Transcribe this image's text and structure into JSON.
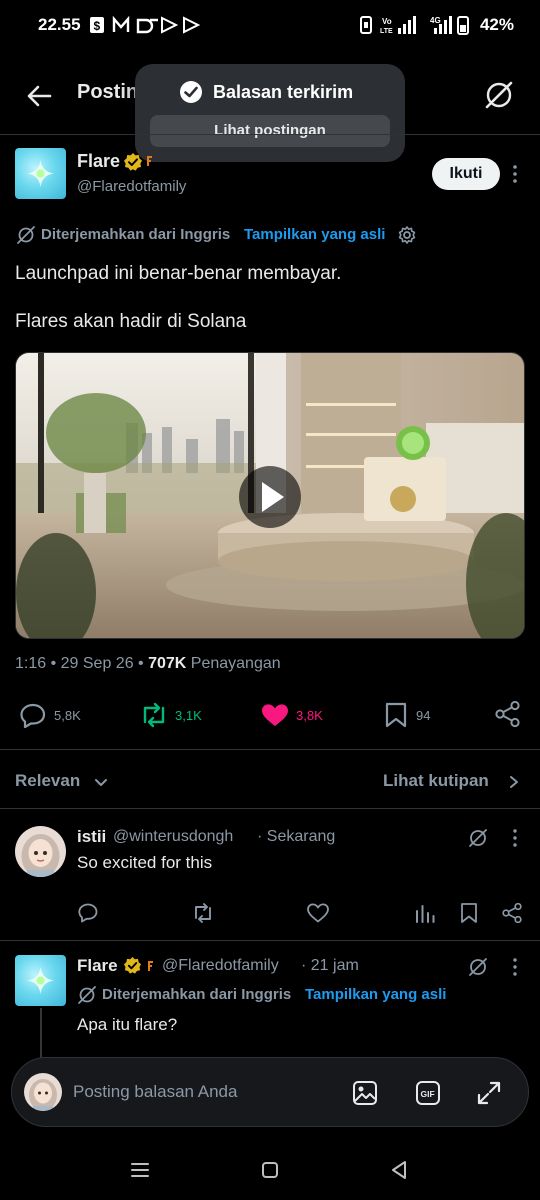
{
  "status": {
    "time": "22.55",
    "battery": "42%",
    "network": "4G",
    "volte": "Vo LTE"
  },
  "topbar": {
    "title": "Postingan"
  },
  "toast": {
    "message": "Balasan terkirim",
    "action": "Lihat postingan"
  },
  "post": {
    "author_name": "Flare",
    "handle": "@Flaredotfamily",
    "follow_label": "Ikuti",
    "translated_note": "Diterjemahkan dari Inggris",
    "show_original": "Tampilkan yang asli",
    "text_line1": "Launchpad ini benar-benar membayar.",
    "text_line2": "Flares akan hadir di Solana",
    "meta_time": "1:16 • 29 Sep 26 • ",
    "meta_views": "707K",
    "meta_views_label": " Penayangan",
    "replies": "5,8K",
    "reposts": "3,1K",
    "likes": "3,8K",
    "bookmarks": "94",
    "colors": {
      "repost": "#00ba7c",
      "like": "#f91880",
      "verified": "#e2b719",
      "link": "#1d9bf0"
    }
  },
  "filter": {
    "sort_label": "Relevan",
    "quotes_label": "Lihat kutipan"
  },
  "reply1": {
    "name": "istii",
    "handle": "@winterusdongh",
    "time": "· Sekarang",
    "text": "So excited for this"
  },
  "reply2": {
    "name": "Flare",
    "handle": "@Flaredotfamily",
    "time": "· 21 jam",
    "translated_note": "Diterjemahkan dari Inggris",
    "show_original": "Tampilkan yang asli",
    "text": "Apa itu flare?"
  },
  "composer": {
    "placeholder": "Posting balasan Anda"
  },
  "icons": [
    "back-arrow-icon",
    "grok-icon",
    "check-circle-icon",
    "verified-badge-icon",
    "more-icon",
    "translate-icon",
    "settings-icon",
    "play-icon",
    "reply-icon",
    "repost-icon",
    "like-icon",
    "bookmark-icon",
    "share-icon",
    "chevron-down-icon",
    "chevron-right-icon",
    "views-icon",
    "image-icon",
    "gif-icon",
    "expand-icon"
  ]
}
